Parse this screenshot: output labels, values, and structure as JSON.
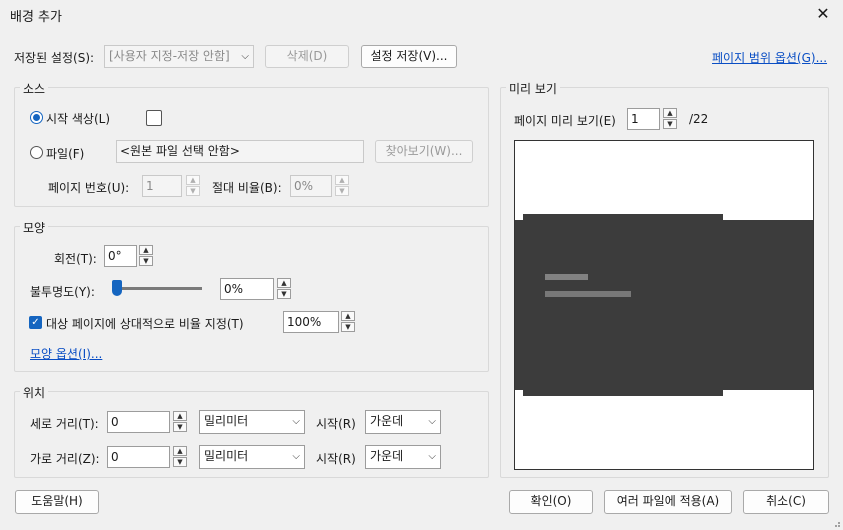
{
  "window": {
    "title": "배경 추가"
  },
  "settings": {
    "saved_label": "저장된 설정(S):",
    "saved_value": "[사용자 지정-저장 안함]",
    "delete_label": "삭제(D)",
    "save_label": "설정 저장(V)...",
    "page_range_link": "페이지 범위 옵션(G)..."
  },
  "source": {
    "title": "소스",
    "color_radio_label": "시작 색상(L)",
    "file_radio_label": "파일(F)",
    "file_value": "<원본 파일 선택 안함>",
    "browse_label": "찾아보기(W)...",
    "page_number_label": "페이지 번호(U):",
    "page_number_value": "1",
    "absolute_scale_label": "절대 비율(B):",
    "absolute_scale_value": "0%",
    "selected": "color"
  },
  "appearance": {
    "title": "모양",
    "rotation_label": "회전(T):",
    "rotation_value": "0°",
    "opacity_label": "불투명도(Y):",
    "opacity_value": "0%",
    "opacity_level": 0,
    "scale_checkbox_label": "대상 페이지에 상대적으로 비율 지정(T)",
    "scale_checked": true,
    "scale_value": "100%",
    "options_link": "모양 옵션(I)..."
  },
  "position": {
    "title": "위치",
    "vertical_label": "세로 거리(T):",
    "vertical_value": "0",
    "vertical_unit": "밀리미터",
    "vertical_from_label": "시작(R)",
    "vertical_from_value": "가운데",
    "horizontal_label": "가로 거리(Z):",
    "horizontal_value": "0",
    "horizontal_unit": "밀리미터",
    "horizontal_from_label": "시작(R)",
    "horizontal_from_value": "가운데"
  },
  "preview": {
    "title": "미리 보기",
    "page_label": "페이지 미리 보기(E)",
    "page_value": "1",
    "page_total": "/22"
  },
  "footer": {
    "help_label": "도움말(H)",
    "ok_label": "확인(O)",
    "apply_multiple_label": "여러 파일에 적용(A)",
    "cancel_label": "취소(C)"
  },
  "colors": {
    "accent": "#1565c0",
    "link": "#0a4ec4",
    "preview_dark": "#3c3c3c"
  },
  "icons": {
    "close": "close-icon",
    "chevron": "chevron-down-icon",
    "spin_up": "spin-up-icon",
    "spin_down": "spin-down-icon"
  }
}
